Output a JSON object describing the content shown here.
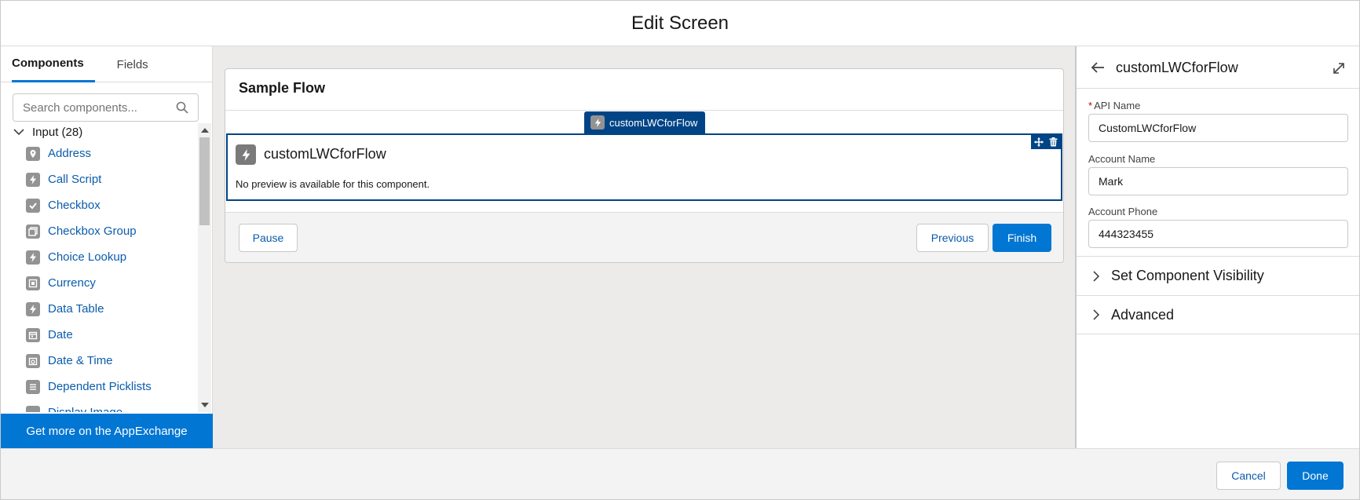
{
  "header": {
    "title": "Edit Screen"
  },
  "palette": {
    "tabs": [
      {
        "label": "Components"
      },
      {
        "label": "Fields"
      }
    ],
    "search": {
      "placeholder": "Search components..."
    },
    "group": {
      "label": "Input (28)"
    },
    "items": [
      {
        "label": "Address",
        "icon": "map-pin-icon"
      },
      {
        "label": "Call Script",
        "icon": "bolt-icon"
      },
      {
        "label": "Checkbox",
        "icon": "checkbox-icon"
      },
      {
        "label": "Checkbox Group",
        "icon": "checkbox-group-icon"
      },
      {
        "label": "Choice Lookup",
        "icon": "bolt-icon"
      },
      {
        "label": "Currency",
        "icon": "currency-icon"
      },
      {
        "label": "Data Table",
        "icon": "bolt-icon"
      },
      {
        "label": "Date",
        "icon": "calendar-icon"
      },
      {
        "label": "Date & Time",
        "icon": "datetime-icon"
      },
      {
        "label": "Dependent Picklists",
        "icon": "list-icon"
      },
      {
        "label": "Display Image",
        "icon": "image-icon"
      }
    ],
    "appexchange_label": "Get more on the AppExchange"
  },
  "canvas": {
    "flow_title": "Sample Flow",
    "component_tag": "customLWCforFlow",
    "component_name": "customLWCforFlow",
    "preview_note": "No preview is available for this component.",
    "buttons": {
      "pause": "Pause",
      "previous": "Previous",
      "finish": "Finish"
    }
  },
  "props": {
    "title": "customLWCforFlow",
    "fields": [
      {
        "label": "API Name",
        "required": true,
        "value": "CustomLWCforFlow"
      },
      {
        "label": "Account Name",
        "required": false,
        "value": "Mark"
      },
      {
        "label": "Account Phone",
        "required": false,
        "value": "444323455"
      }
    ],
    "required_marker": "*",
    "sections": [
      {
        "label": "Set Component Visibility"
      },
      {
        "label": "Advanced"
      }
    ]
  },
  "footer": {
    "cancel": "Cancel",
    "done": "Done"
  },
  "colors": {
    "brand": "#0176d3",
    "selected": "#014486",
    "link": "#0b5cab",
    "icon_gray": "#939393"
  }
}
